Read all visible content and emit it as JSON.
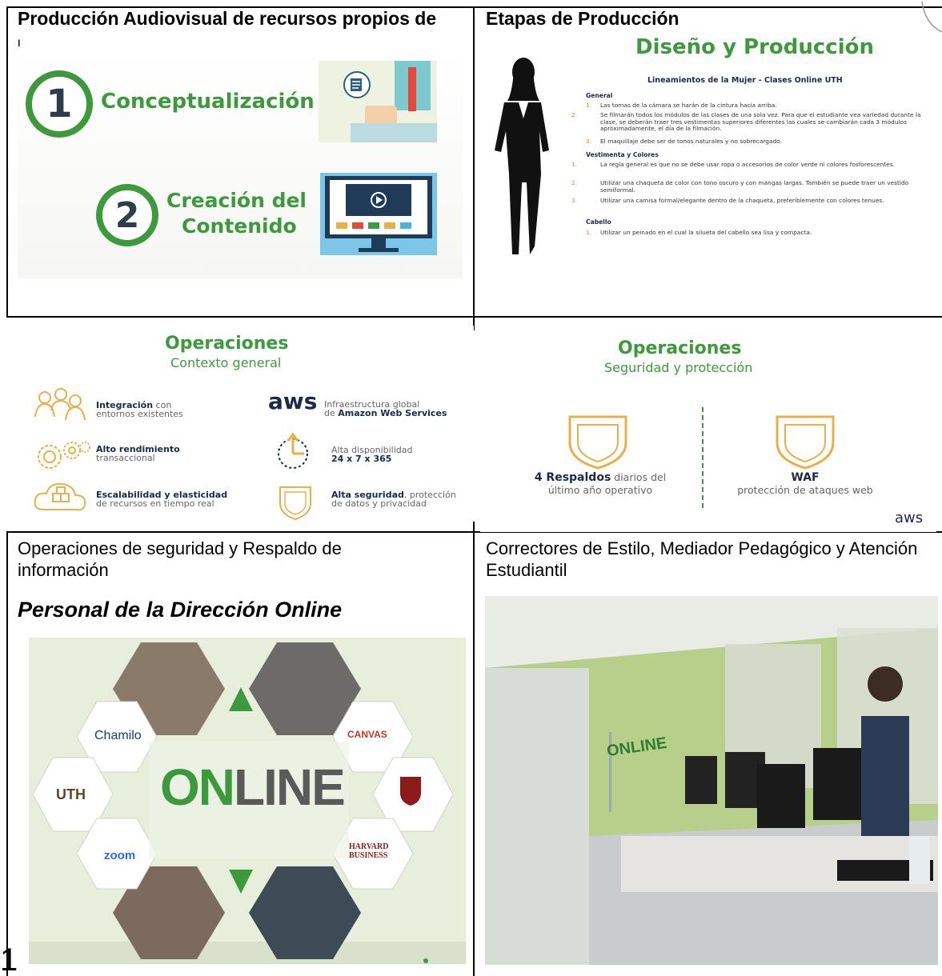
{
  "cells": {
    "top_left_title": "Producción Audiovisual de recursos propios de",
    "top_left_title_overflow": "l",
    "top_right_title": "Etapas de Producción",
    "bottom_left_caption": "Operaciones de seguridad y Respaldo de información",
    "bottom_left_heading": "Personal de la Dirección Online",
    "bottom_right_caption": "Correctores de Estilo, Mediador Pedagógico y Atención Estudiantil",
    "page_mark": "1"
  },
  "slide_conceptualization": {
    "step1_number": "1",
    "step1_label": "Conceptualización",
    "step2_number": "2",
    "step2_label_line1": "Creación del",
    "step2_label_line2": "Contenido"
  },
  "slide_design": {
    "title": "Diseño y Producción",
    "subtitle": "Lineamientos de la Mujer - Clases Online UTH",
    "sections": [
      {
        "heading": "General",
        "items": [
          {
            "n": "1.",
            "text": "Las tomas de la cámara se harán de la cintura hacia arriba."
          },
          {
            "n": "2.",
            "text": "Se filmarán todos los módulos de las clases de una sola vez. Para que el estudiante vea variedad durante la clase, se deberán traer tres vestimentas superiores diferentes las cuales se cambiarán cada 3 módulos aproximadamente, el día de la filmación."
          },
          {
            "n": "3.",
            "text": "El maquillaje debe ser de tonos naturales y no sobrecargado."
          }
        ]
      },
      {
        "heading": "Vestimenta y Colores",
        "items": [
          {
            "n": "1.",
            "text": "La regla general es que no se debe usar ropa o accesorios de color verde ni colores fosforescentes."
          },
          {
            "n": "2.",
            "text": "Utilizar una chaqueta de color con tono oscuro y con mangas largas. También se puede traer un vestido semiformal."
          },
          {
            "n": "3.",
            "text": "Utilizar una camisa formal/elegante dentro de la chaqueta, preferiblemente con colores tenues."
          }
        ]
      },
      {
        "heading": "Cabello",
        "items": [
          {
            "n": "1.",
            "text": "Utilizar un peinado en el cual la silueta del cabello sea lisa y compacta."
          }
        ]
      }
    ]
  },
  "slide_operations_context": {
    "title": "Operaciones",
    "subtitle": "Contexto general",
    "features": [
      {
        "bold": "Integración",
        "rest": " con",
        "line2": "entornos existentes",
        "icon": "people-icon"
      },
      {
        "bold": "Alto rendimiento",
        "rest": "",
        "line2": "transaccional",
        "icon": "gears-icon"
      },
      {
        "bold": "Escalabilidad y elasticidad",
        "rest": "",
        "line2": "de recursos en tiempo real",
        "icon": "cloud-boxes-icon"
      },
      {
        "bold": "",
        "rest": "Infraestructura global",
        "line2_prefix": "de ",
        "line2_bold": "Amazon Web Services",
        "icon": "aws-logo"
      },
      {
        "bold": "",
        "rest": "Alta disponibilidad",
        "line2_bold": "24 x 7 x 365",
        "icon": "clock-icon"
      },
      {
        "bold": "Alta seguridad",
        "rest": ", protección",
        "line2": "de datos y privacidad",
        "icon": "shield-icon"
      }
    ],
    "aws_text": "aws"
  },
  "slide_operations_security": {
    "title": "Operaciones",
    "subtitle": "Seguridad y protección",
    "left_bold": "4 Respaldos",
    "left_rest": " diarios del",
    "left_line2": "último año operativo",
    "right_bold": "WAF",
    "right_line2": "protección de ataques web",
    "aws_text": "aws"
  },
  "photo_wall": {
    "online_text_1": "ON",
    "online_text_2": "LINE",
    "logos": [
      "Chamilo",
      "CANVAS",
      "UTH",
      "zoom",
      "HARVARD BUSINESS"
    ]
  },
  "photo_office": {
    "wall_text": "ONLINE"
  },
  "colors": {
    "green": "#3c9a3c",
    "navy": "#1a2a48",
    "orange": "#e8b04a",
    "office_wall": "#a9c97a"
  }
}
